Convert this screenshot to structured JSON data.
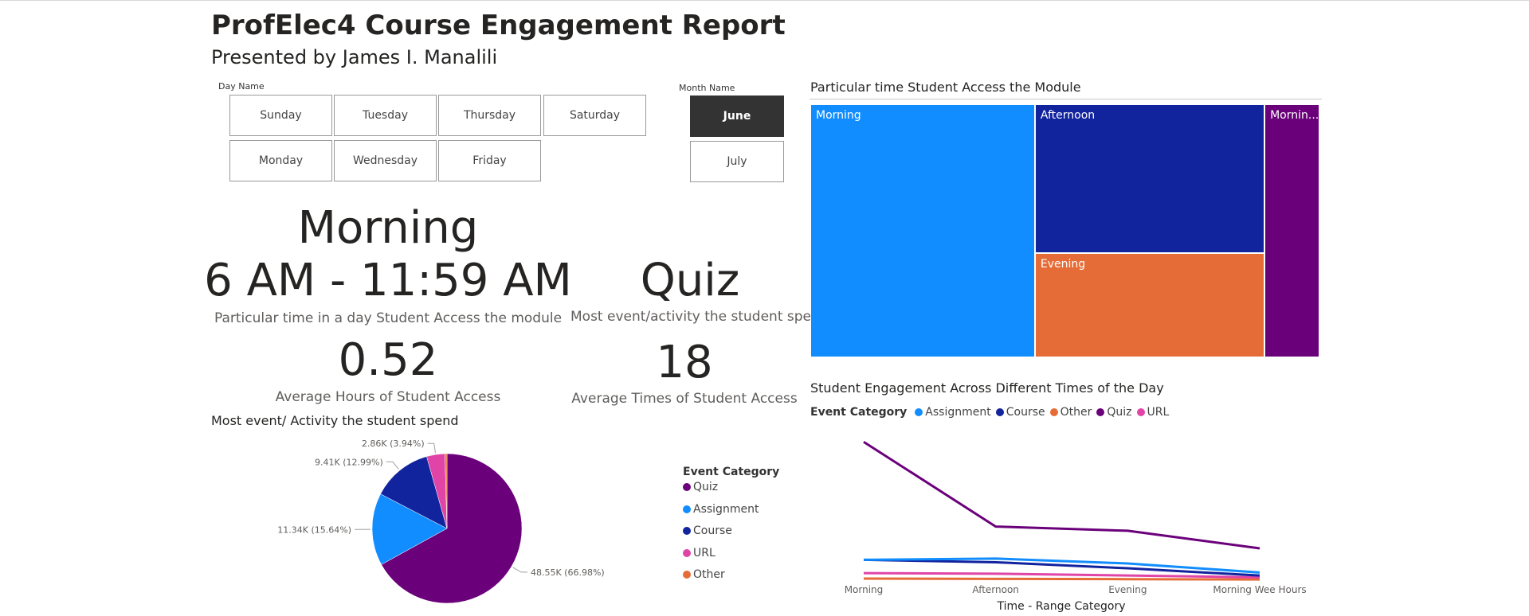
{
  "report": {
    "title": "ProfElec4 Course Engagement Report",
    "subtitle": "Presented by James I. Manalili"
  },
  "day_slicer": {
    "label": "Day Name",
    "options": [
      "Sunday",
      "Tuesday",
      "Thursday",
      "Saturday",
      "Monday",
      "Wednesday",
      "Friday"
    ]
  },
  "month_slicer": {
    "label": "Month Name",
    "options": [
      "June",
      "July"
    ],
    "selected": "June"
  },
  "cards": {
    "time": {
      "value_line1": "Morning",
      "value_line2": "6 AM - 11:59 AM",
      "caption": "Particular time in a day Student Access the module"
    },
    "activity": {
      "value": "Quiz",
      "caption": "Most event/activity the student spend"
    },
    "avg_hours": {
      "value": "0.52",
      "caption": "Average Hours of Student Access"
    },
    "avg_times": {
      "value": "18",
      "caption": "Average Times of Student Access"
    }
  },
  "colors": {
    "Quiz": "#6b007b",
    "Assignment": "#118dff",
    "Course": "#12239e",
    "URL": "#e044a7",
    "Other": "#e66c37"
  },
  "chart_data": [
    {
      "type": "treemap",
      "title": "Particular time Student Access the Module",
      "labels": [
        "Morning",
        "Afternoon",
        "Evening",
        "Mornin..."
      ],
      "values": [
        45,
        27,
        19,
        11
      ]
    },
    {
      "type": "line",
      "title": "Student Engagement Across Different Times of the Day",
      "legend_title": "Event Category",
      "legend": [
        "Assignment",
        "Course",
        "Other",
        "Quiz",
        "URL"
      ],
      "xlabel": "Time - Range Category",
      "categories": [
        "Morning",
        "Afternoon",
        "Evening",
        "Morning Wee Hours"
      ],
      "ylim": [
        0,
        25000
      ],
      "series": [
        {
          "name": "Quiz",
          "values": [
            23000,
            9000,
            8300,
            5400
          ]
        },
        {
          "name": "Assignment",
          "values": [
            3500,
            3700,
            2900,
            1400
          ]
        },
        {
          "name": "Course",
          "values": [
            3500,
            3100,
            2100,
            900
          ]
        },
        {
          "name": "URL",
          "values": [
            1300,
            1200,
            900,
            600
          ]
        },
        {
          "name": "Other",
          "values": [
            400,
            350,
            300,
            250
          ]
        }
      ]
    },
    {
      "type": "pie",
      "title": "Most event/ Activity the student spend",
      "legend_title": "Event Category",
      "slices": [
        {
          "name": "Quiz",
          "value": 48550,
          "label": "48.55K (66.98%)"
        },
        {
          "name": "Assignment",
          "value": 11340,
          "label": "11.34K (15.64%)"
        },
        {
          "name": "Course",
          "value": 9410,
          "label": "9.41K (12.99%)"
        },
        {
          "name": "URL",
          "value": 2860,
          "label": "2.86K (3.94%)"
        },
        {
          "name": "Other",
          "value": 320,
          "label": ""
        }
      ]
    }
  ]
}
